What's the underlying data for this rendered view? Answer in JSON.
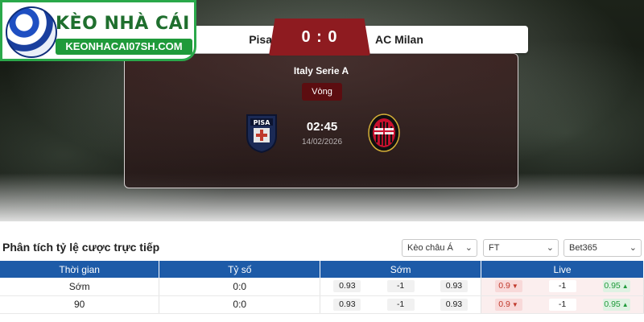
{
  "logo": {
    "title": "KÈO NHÀ CÁI",
    "domain": "KEONHACAI07SH.COM"
  },
  "match": {
    "home_team": "Pisa",
    "away_team": "AC Milan",
    "score": "0 : 0",
    "league": "Italy Serie A",
    "round": "Vòng",
    "kickoff_time": "02:45",
    "date": "14/02/2026"
  },
  "analysis": {
    "title": "Phân tích tỷ lệ cược trực tiếp",
    "filters": {
      "market": "Kèo châu Á",
      "period": "FT",
      "bookmaker": "Bet365"
    },
    "headers": [
      "Thời gian",
      "Tỷ số",
      "Sớm",
      "Live"
    ],
    "rows": [
      {
        "time": "Sớm",
        "score": "0:0",
        "early": [
          "0.93",
          "-1",
          "0.93"
        ],
        "live": [
          "0.9",
          "-1",
          "0.95"
        ]
      },
      {
        "time": "90",
        "score": "0:0",
        "early": [
          "0.93",
          "-1",
          "0.93"
        ],
        "live": [
          "0.9",
          "-1",
          "0.95"
        ]
      }
    ]
  },
  "colors": {
    "accent": "#8e1b20",
    "header_blue": "#1d5ba8",
    "logo_green": "#1f9a3a"
  }
}
